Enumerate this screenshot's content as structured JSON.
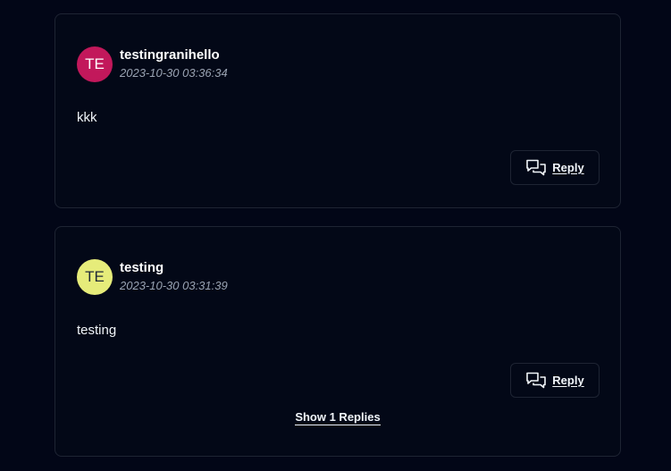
{
  "comments": [
    {
      "avatar_initials": "TE",
      "avatar_color": "#c2185b",
      "avatar_text_color": "#ffffff",
      "username": "testingranihello",
      "timestamp": "2023-10-30 03:36:34",
      "text": "kkk",
      "reply_label": "Reply",
      "reply_icon": "chat-bubbles-icon"
    },
    {
      "avatar_initials": "TE",
      "avatar_color": "#e6ec7a",
      "avatar_text_color": "#1f2937",
      "username": "testing",
      "timestamp": "2023-10-30 03:31:39",
      "text": "testing",
      "reply_label": "Reply",
      "reply_icon": "chat-bubbles-icon",
      "show_replies_label": "Show 1 Replies"
    }
  ]
}
